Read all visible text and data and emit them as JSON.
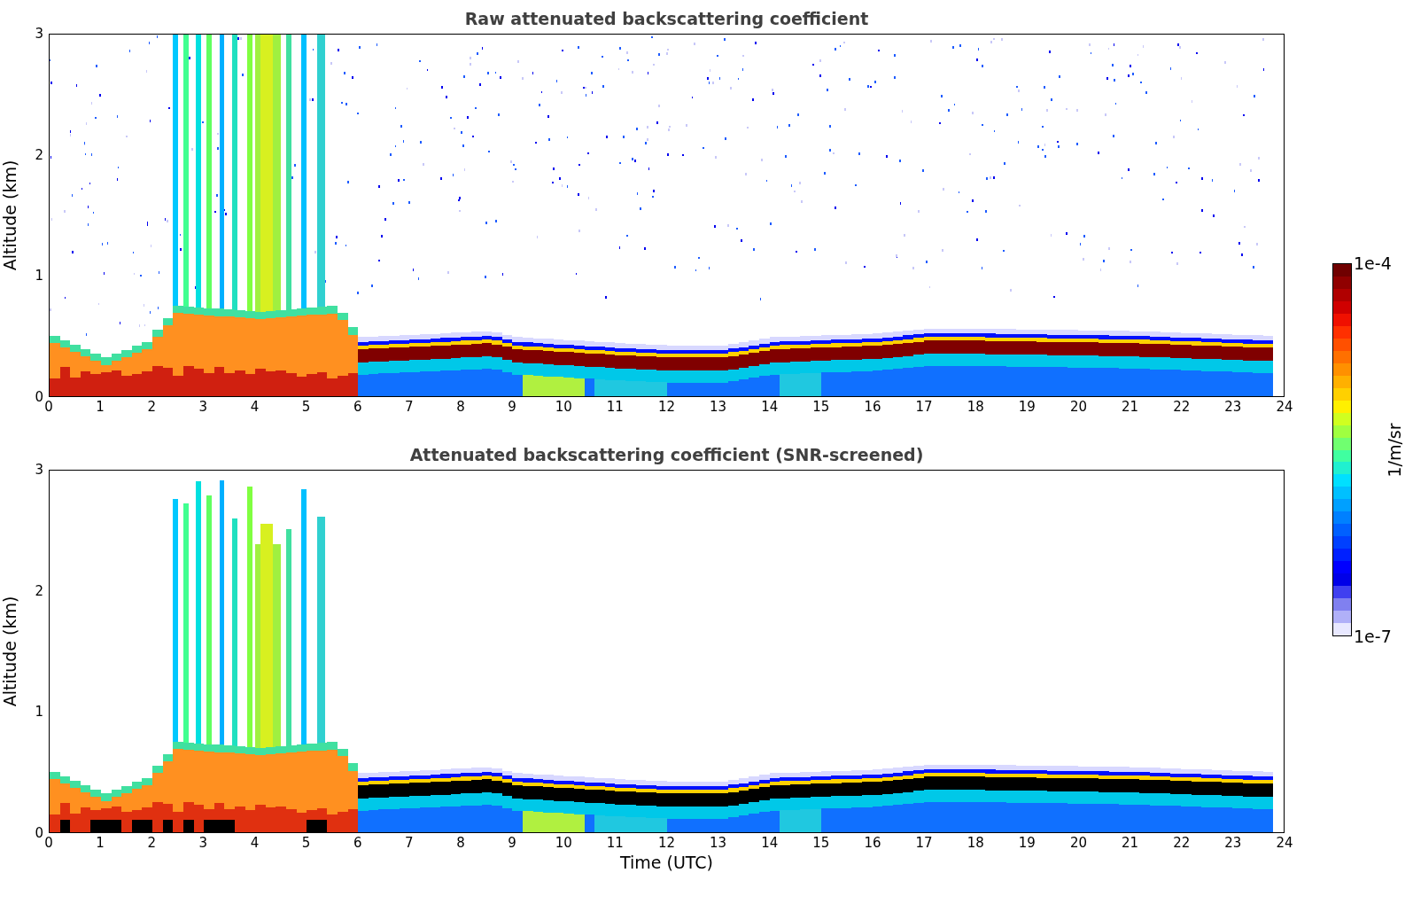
{
  "panels": [
    {
      "kind": "raw",
      "title": "Raw attenuated backscattering coefficient",
      "ylabel": "Altitude (km)",
      "yticks": [
        "3",
        "2",
        "1",
        "0"
      ],
      "xticks": [
        "0",
        "1",
        "2",
        "3",
        "4",
        "5",
        "6",
        "7",
        "8",
        "9",
        "10",
        "11",
        "12",
        "13",
        "14",
        "15",
        "16",
        "17",
        "18",
        "19",
        "20",
        "21",
        "22",
        "23",
        "24"
      ]
    },
    {
      "kind": "screened",
      "title": "Attenuated backscattering coefficient (SNR-screened)",
      "ylabel": "Altitude (km)",
      "yticks": [
        "3",
        "2",
        "1",
        "0"
      ],
      "xticks": [
        "0",
        "1",
        "2",
        "3",
        "4",
        "5",
        "6",
        "7",
        "8",
        "9",
        "10",
        "11",
        "12",
        "13",
        "14",
        "15",
        "16",
        "17",
        "18",
        "19",
        "20",
        "21",
        "22",
        "23",
        "24"
      ],
      "xlabel": "Time (UTC)"
    }
  ],
  "colorbar": {
    "max": "1e-4",
    "min": "1e-7",
    "label": "1/m/sr"
  }
}
